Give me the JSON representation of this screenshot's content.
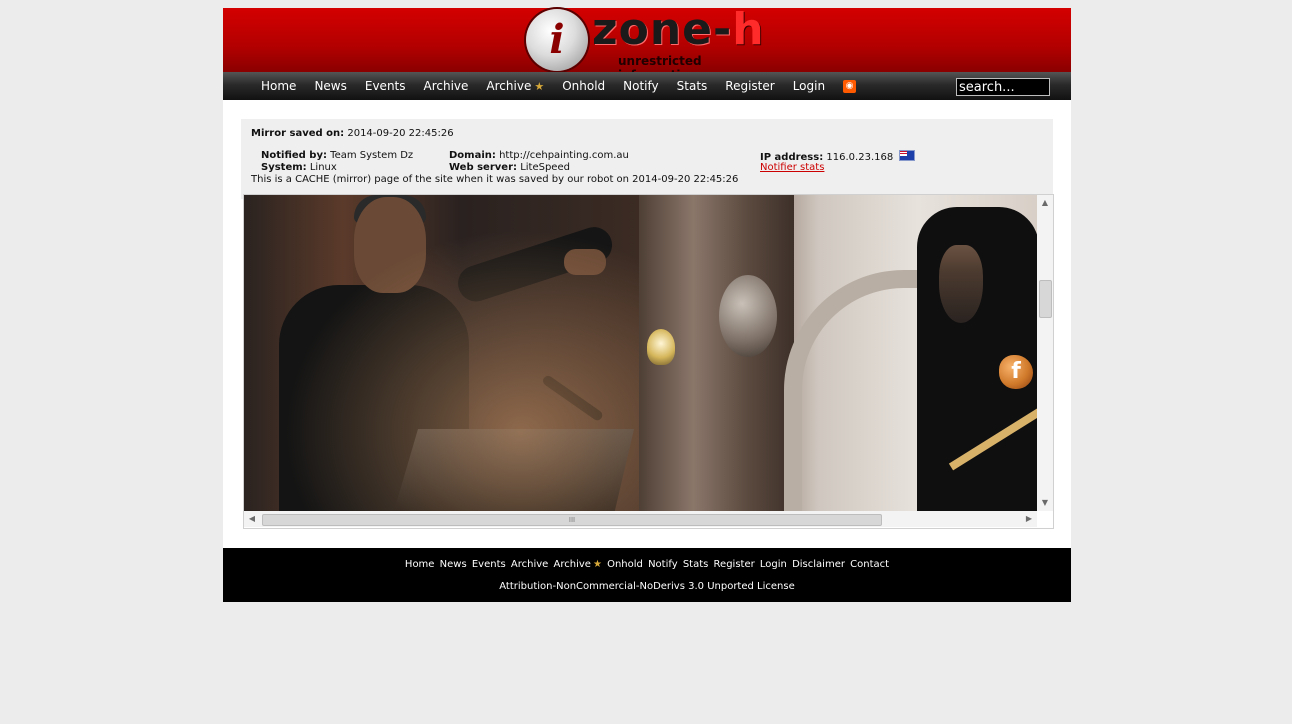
{
  "logo": {
    "word_main": "zone-",
    "word_accent": "h",
    "tagline": "unrestricted information"
  },
  "nav": {
    "items": [
      {
        "label": "Home"
      },
      {
        "label": "News"
      },
      {
        "label": "Events"
      },
      {
        "label": "Archive"
      },
      {
        "label": "Archive",
        "icon": "star-icon"
      },
      {
        "label": "Onhold"
      },
      {
        "label": "Notify"
      },
      {
        "label": "Stats"
      },
      {
        "label": "Register"
      },
      {
        "label": "Login"
      }
    ],
    "rss_icon": "rss-icon",
    "search_value": "search..."
  },
  "mirror": {
    "saved_label": "Mirror saved on:",
    "saved_value": "2014-09-20 22:45:26",
    "notified_label": "Notified by:",
    "notified_value": "Team System Dz",
    "domain_label": "Domain:",
    "domain_value": "http://cehpainting.com.au",
    "ip_label": "IP address:",
    "ip_value": "116.0.23.168",
    "flag_icon": "australia-flag-icon",
    "system_label": "System:",
    "system_value": "Linux",
    "webserver_label": "Web server:",
    "webserver_value": "LiteSpeed",
    "notifier_stats": "Notifier stats",
    "cache_note": "This is a CACHE (mirror) page of the site when it was saved by our robot on 2014-09-20 22:45:26"
  },
  "mirror_content": {
    "facebook_badge": "f",
    "hscroll_grip": "III"
  },
  "footer": {
    "links": [
      "Home",
      "News",
      "Events",
      "Archive",
      "Archive",
      "Onhold",
      "Notify",
      "Stats",
      "Register",
      "Login",
      "Disclaimer",
      "Contact"
    ],
    "license": "Attribution-NonCommercial-NoDerivs 3.0 Unported License"
  }
}
